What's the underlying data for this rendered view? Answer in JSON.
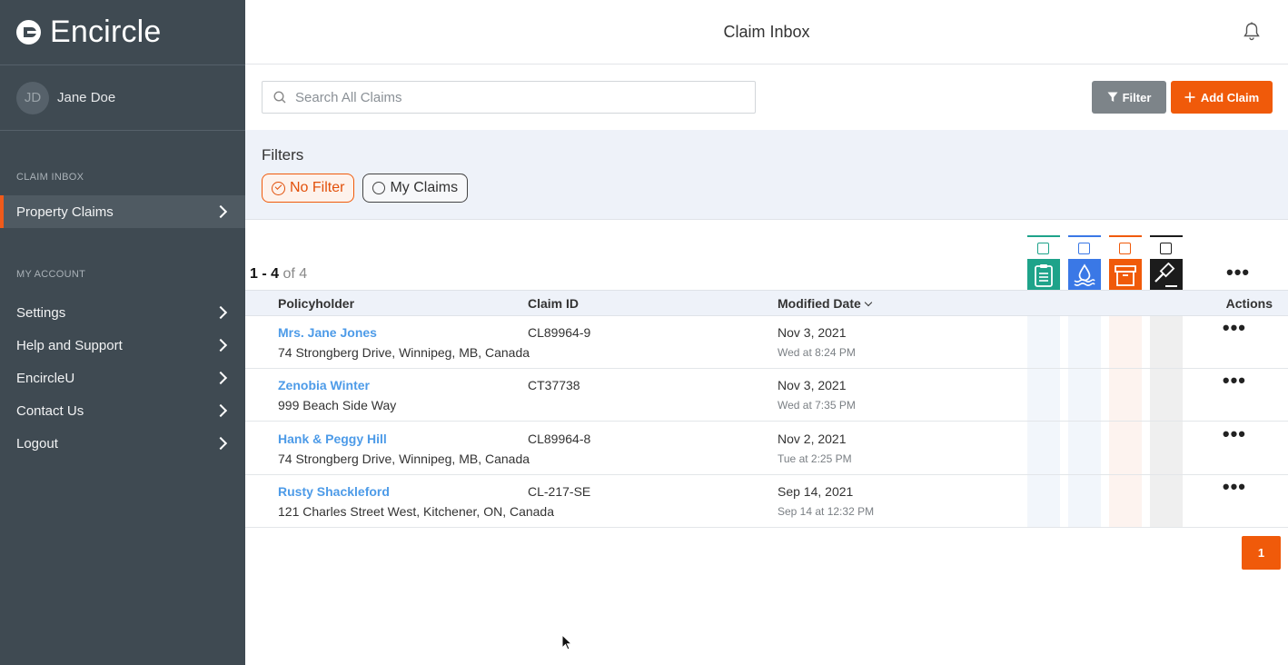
{
  "brand": {
    "name": "Encircle"
  },
  "user": {
    "initials": "JD",
    "name": "Jane Doe"
  },
  "sidebar": {
    "section_claims": "CLAIM INBOX",
    "claims_items": [
      {
        "label": "Property Claims",
        "active": true
      }
    ],
    "section_account": "MY ACCOUNT",
    "account_items": [
      {
        "label": "Settings"
      },
      {
        "label": "Help and Support"
      },
      {
        "label": "EncircleU"
      },
      {
        "label": "Contact Us"
      },
      {
        "label": "Logout"
      }
    ]
  },
  "header": {
    "title": "Claim Inbox",
    "icon": "bell-icon"
  },
  "toolbar": {
    "search_placeholder": "Search All Claims",
    "filter_label": "Filter",
    "add_label": "Add Claim"
  },
  "filters": {
    "title": "Filters",
    "chips": [
      {
        "label": "No Filter",
        "selected": true
      },
      {
        "label": "My Claims",
        "selected": false
      }
    ]
  },
  "results": {
    "range": "1 - 4",
    "of_label": "of 4",
    "claim_types": [
      {
        "name": "clipboard-icon",
        "color": "#1ea38a"
      },
      {
        "name": "water-drop-icon",
        "color": "#3a78e6"
      },
      {
        "name": "archive-box-icon",
        "color": "#f05a0a"
      },
      {
        "name": "gavel-icon",
        "color": "#1c1c1c"
      }
    ]
  },
  "table": {
    "columns": {
      "policyholder": "Policyholder",
      "claim_id": "Claim ID",
      "modified": "Modified Date",
      "actions": "Actions"
    },
    "rows": [
      {
        "name": "Mrs. Jane Jones",
        "address": "74 Strongberg Drive, Winnipeg, MB, Canada",
        "claim_id": "CL89964-9",
        "date": "Nov 3, 2021",
        "time": "Wed at 8:24 PM"
      },
      {
        "name": "Zenobia Winter",
        "address": "999 Beach Side Way",
        "claim_id": "CT37738",
        "date": "Nov 3, 2021",
        "time": "Wed at 7:35 PM"
      },
      {
        "name": "Hank & Peggy Hill",
        "address": "74 Strongberg Drive, Winnipeg, MB, Canada",
        "claim_id": "CL89964-8",
        "date": "Nov 2, 2021",
        "time": "Tue at 2:25 PM"
      },
      {
        "name": "Rusty Shackleford",
        "address": "121 Charles Street West, Kitchener, ON, Canada",
        "claim_id": "CL-217-SE",
        "date": "Sep 14, 2021",
        "time": "Sep 14 at 12:32 PM"
      }
    ]
  },
  "pagination": {
    "current": "1"
  }
}
